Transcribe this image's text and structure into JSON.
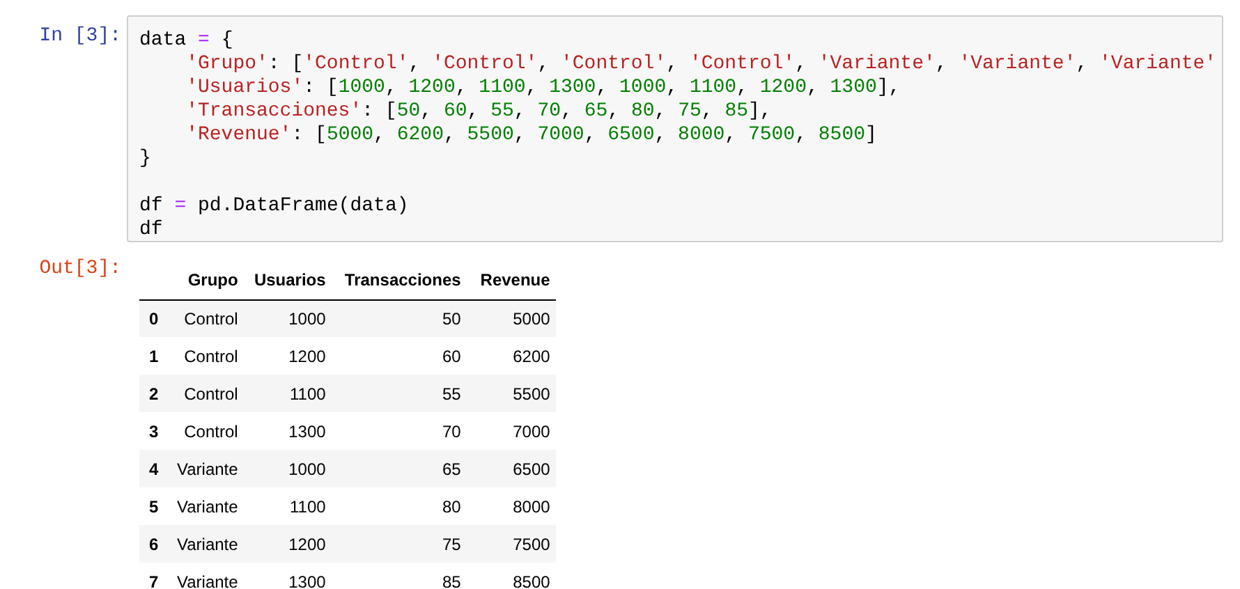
{
  "input_cell": {
    "prompt": "In [3]:",
    "code_lines": [
      {
        "kind": "code",
        "tokens": [
          {
            "kind": "plain",
            "text": "data "
          },
          {
            "kind": "operator",
            "text": "="
          },
          {
            "kind": "plain",
            "text": " {"
          }
        ]
      },
      {
        "kind": "indented",
        "tokens": [
          {
            "kind": "string",
            "text": "'Grupo'"
          },
          {
            "kind": "plain",
            "text": ": ["
          },
          {
            "kind": "string",
            "text": "'Control'"
          },
          {
            "kind": "plain",
            "text": ", "
          },
          {
            "kind": "string",
            "text": "'Control'"
          },
          {
            "kind": "plain",
            "text": ", "
          },
          {
            "kind": "string",
            "text": "'Control'"
          },
          {
            "kind": "plain",
            "text": ", "
          },
          {
            "kind": "string",
            "text": "'Control'"
          },
          {
            "kind": "plain",
            "text": ", "
          },
          {
            "kind": "string",
            "text": "'Variante'"
          },
          {
            "kind": "plain",
            "text": ", "
          },
          {
            "kind": "string",
            "text": "'Variante'"
          },
          {
            "kind": "plain",
            "text": ", "
          },
          {
            "kind": "string",
            "text": "'Variante'"
          }
        ]
      },
      {
        "kind": "indented",
        "tokens": [
          {
            "kind": "string",
            "text": "'Usuarios'"
          },
          {
            "kind": "plain",
            "text": ": ["
          },
          {
            "kind": "number",
            "text": "1000"
          },
          {
            "kind": "plain",
            "text": ", "
          },
          {
            "kind": "number",
            "text": "1200"
          },
          {
            "kind": "plain",
            "text": ", "
          },
          {
            "kind": "number",
            "text": "1100"
          },
          {
            "kind": "plain",
            "text": ", "
          },
          {
            "kind": "number",
            "text": "1300"
          },
          {
            "kind": "plain",
            "text": ", "
          },
          {
            "kind": "number",
            "text": "1000"
          },
          {
            "kind": "plain",
            "text": ", "
          },
          {
            "kind": "number",
            "text": "1100"
          },
          {
            "kind": "plain",
            "text": ", "
          },
          {
            "kind": "number",
            "text": "1200"
          },
          {
            "kind": "plain",
            "text": ", "
          },
          {
            "kind": "number",
            "text": "1300"
          },
          {
            "kind": "plain",
            "text": "],"
          }
        ]
      },
      {
        "kind": "indented",
        "tokens": [
          {
            "kind": "string",
            "text": "'Transacciones'"
          },
          {
            "kind": "plain",
            "text": ": ["
          },
          {
            "kind": "number",
            "text": "50"
          },
          {
            "kind": "plain",
            "text": ", "
          },
          {
            "kind": "number",
            "text": "60"
          },
          {
            "kind": "plain",
            "text": ", "
          },
          {
            "kind": "number",
            "text": "55"
          },
          {
            "kind": "plain",
            "text": ", "
          },
          {
            "kind": "number",
            "text": "70"
          },
          {
            "kind": "plain",
            "text": ", "
          },
          {
            "kind": "number",
            "text": "65"
          },
          {
            "kind": "plain",
            "text": ", "
          },
          {
            "kind": "number",
            "text": "80"
          },
          {
            "kind": "plain",
            "text": ", "
          },
          {
            "kind": "number",
            "text": "75"
          },
          {
            "kind": "plain",
            "text": ", "
          },
          {
            "kind": "number",
            "text": "85"
          },
          {
            "kind": "plain",
            "text": "],"
          }
        ]
      },
      {
        "kind": "indented",
        "tokens": [
          {
            "kind": "string",
            "text": "'Revenue'"
          },
          {
            "kind": "plain",
            "text": ": ["
          },
          {
            "kind": "number",
            "text": "5000"
          },
          {
            "kind": "plain",
            "text": ", "
          },
          {
            "kind": "number",
            "text": "6200"
          },
          {
            "kind": "plain",
            "text": ", "
          },
          {
            "kind": "number",
            "text": "5500"
          },
          {
            "kind": "plain",
            "text": ", "
          },
          {
            "kind": "number",
            "text": "7000"
          },
          {
            "kind": "plain",
            "text": ", "
          },
          {
            "kind": "number",
            "text": "6500"
          },
          {
            "kind": "plain",
            "text": ", "
          },
          {
            "kind": "number",
            "text": "8000"
          },
          {
            "kind": "plain",
            "text": ", "
          },
          {
            "kind": "number",
            "text": "7500"
          },
          {
            "kind": "plain",
            "text": ", "
          },
          {
            "kind": "number",
            "text": "8500"
          },
          {
            "kind": "plain",
            "text": "]"
          }
        ]
      },
      {
        "kind": "code",
        "tokens": [
          {
            "kind": "plain",
            "text": "}"
          }
        ]
      },
      {
        "kind": "blank"
      },
      {
        "kind": "code",
        "tokens": [
          {
            "kind": "plain",
            "text": "df "
          },
          {
            "kind": "operator",
            "text": "="
          },
          {
            "kind": "plain",
            "text": " pd.DataFrame(data)"
          }
        ]
      },
      {
        "kind": "code",
        "tokens": [
          {
            "kind": "plain",
            "text": "df"
          }
        ]
      }
    ]
  },
  "output_cell": {
    "prompt": "Out[3]:",
    "table": {
      "columns": [
        "Grupo",
        "Usuarios",
        "Transacciones",
        "Revenue"
      ],
      "rows": [
        {
          "index": "0",
          "cells": [
            "Control",
            "1000",
            "50",
            "5000"
          ]
        },
        {
          "index": "1",
          "cells": [
            "Control",
            "1200",
            "60",
            "6200"
          ]
        },
        {
          "index": "2",
          "cells": [
            "Control",
            "1100",
            "55",
            "5500"
          ]
        },
        {
          "index": "3",
          "cells": [
            "Control",
            "1300",
            "70",
            "7000"
          ]
        },
        {
          "index": "4",
          "cells": [
            "Variante",
            "1000",
            "65",
            "6500"
          ]
        },
        {
          "index": "5",
          "cells": [
            "Variante",
            "1100",
            "80",
            "8000"
          ]
        },
        {
          "index": "6",
          "cells": [
            "Variante",
            "1200",
            "75",
            "7500"
          ]
        },
        {
          "index": "7",
          "cells": [
            "Variante",
            "1300",
            "85",
            "8500"
          ]
        }
      ]
    }
  }
}
